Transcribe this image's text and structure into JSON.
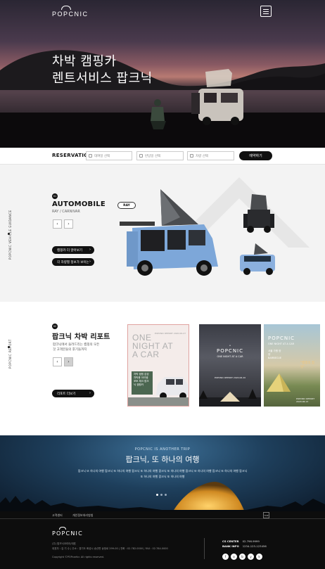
{
  "header": {
    "logo": "POPCNIC",
    "hero_line1": "차박 캠핑카",
    "hero_line2": "렌트서비스 팝크닉"
  },
  "reservation": {
    "label": "RESERVATION",
    "field1": "대여일 선택",
    "field2": "반납일 선택",
    "field3": "차량 선택",
    "button": "예약하기"
  },
  "automobile": {
    "side_label": "POPCNIC VEHICLE GUIDANCE",
    "number": "01",
    "title": "AUTOMOBILE",
    "subtitle": "RAY / CARNIVAR",
    "tag": "RAY",
    "btn_prev": "‹",
    "btn_next": "›",
    "pill1": "캠핑카 더 알아보기",
    "pill2": "각 차량별 정보가 보이는"
  },
  "report": {
    "side_label": "POPCNIC REPORT",
    "number": "02",
    "title": "팝크닉 차박 리포트",
    "desc": "팝크닉에서 들려드리는 캠핑의 모든 것 고객분들의 후기들까지",
    "btn_prev": "‹",
    "btn_next": "›",
    "pill": "리포트 더보기",
    "card1_big": "ONE NIGHT AT A CAR",
    "card1_small": "POPCNIC REPORT 2020.06.27",
    "card1_green": "차박 캠핑 감성 차박용 아이템 포토 체크 팝크닉 캠핑카",
    "card2_logo": "POPCNIC",
    "card2_sub": "ONE NIGHT AT A CAR",
    "card2_foot": "POPCNIC REPORT 2020.06.20",
    "card3_logo": "POPCNIC",
    "card3_sub": "ONE NIGHT AT A CAR",
    "card3_list": "서울 가평 양양 BARBECUE",
    "card3_accent": "\"캠핑의 참맛\"",
    "card3_foot": "POPCNIC REPORT 2020.06.13"
  },
  "banner": {
    "sub": "POPCNIC IS ANOTHER TRIP",
    "title": "팝크닉, 또 하나의 여행",
    "text": "팝크닉 또 하나의 여행 팝크닉 또 하나의 여행 팝크닉 또 하나의 여행 팝크닉 또 하나의 여행 팝크닉 또 하나의 여행 팝크닉 또 하나의 여행 팝크닉 또 하나의 여행 팝크닉 또 하나의 여행"
  },
  "footer": {
    "link1": "고객센터",
    "link2": "개인정보처리방침",
    "top": "TOP",
    "logo": "POPCNIC",
    "company": "(주) 팝크닉코리아/대표",
    "address": "대표자 : 김 기 수  |  주소 : 경기도 화성시 송산면 송정로 299-00  |  전화 : 02.782.0000  |  FAX : 02.784.0000",
    "copyright": "Copyright ©POPcarfor. All rights reserved.",
    "cs_label": "CS CENTER",
    "cs_value": "02.796.9999",
    "bank_label": "BANK INFO",
    "bank_value": "1234-123-123456",
    "socials": [
      "f",
      "o",
      "b",
      "y",
      "k"
    ]
  }
}
